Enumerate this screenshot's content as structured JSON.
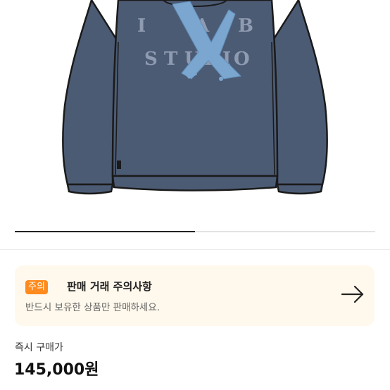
{
  "product": {
    "graphic_letters": [
      "I",
      "A",
      "B",
      "S",
      "T",
      "U",
      "D",
      "I",
      "O"
    ],
    "graphic_mark": "X",
    "sweatshirt_color": "#4c5b74",
    "mark_color": "#7aa6cf",
    "icon": "sweatshirt-illustration"
  },
  "carousel": {
    "progress": 0.5
  },
  "notice": {
    "badge": "주의",
    "title": "판매 거래 주의사항",
    "body": "반드시 보유한 상품만 판매하세요.",
    "arrow_icon": "arrow-right-icon",
    "badge_color": "#ff8a1d",
    "background": "#fff8ec"
  },
  "price": {
    "label": "즉시 구매가",
    "value": "145,000원"
  }
}
